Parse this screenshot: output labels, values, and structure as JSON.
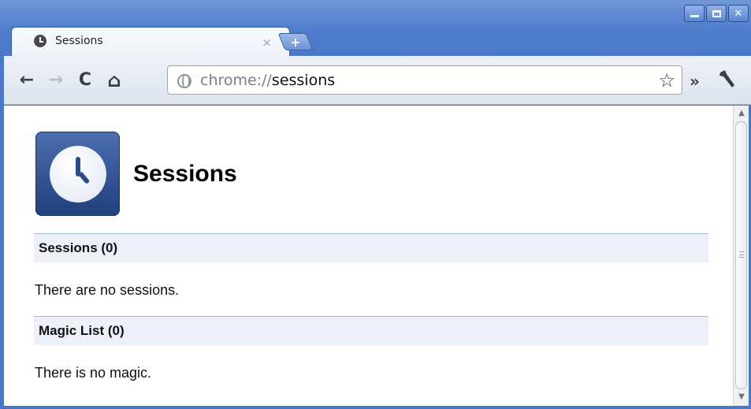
{
  "window": {
    "controls": [
      "minimize",
      "maximize",
      "close"
    ],
    "close_glyph": "✕"
  },
  "tab": {
    "title": "Sessions",
    "favicon": "clock-icon",
    "close_glyph": "×"
  },
  "new_tab": {
    "glyph": "+"
  },
  "toolbar": {
    "back_glyph": "←",
    "forward_glyph": "→",
    "reload_glyph": "C",
    "home_glyph": "⌂",
    "url_scheme": "chrome://",
    "url_host": "sessions",
    "star_glyph": "☆",
    "chevron_glyph": "»",
    "wrench_glyph": "🔧"
  },
  "page": {
    "title": "Sessions",
    "icon": "clock-icon",
    "sections": [
      {
        "heading": "Sessions (0)",
        "message": "There are no sessions."
      },
      {
        "heading": "Magic List (0)",
        "message": "There is no magic."
      }
    ]
  },
  "scrollbar": {
    "up_glyph": "▲",
    "down_glyph": "▼"
  },
  "colors": {
    "frame_blue": "#4e7ccb",
    "section_bg": "#ebf0fa",
    "section_border": "#9fbce0",
    "icon_blue": "#2a4c8e"
  }
}
